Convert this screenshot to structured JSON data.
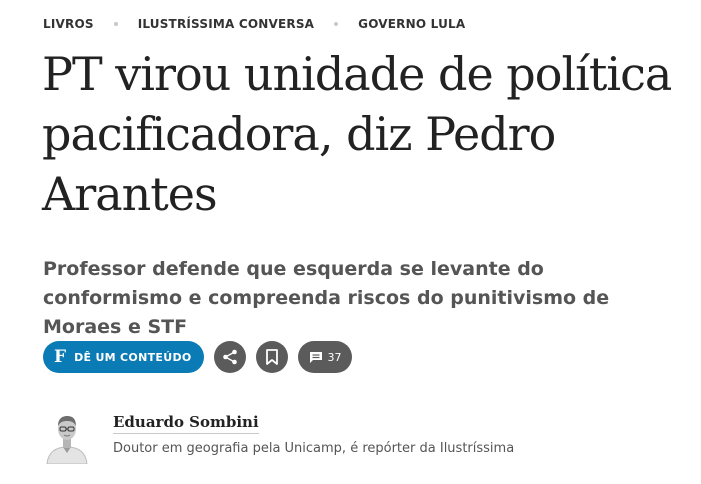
{
  "tags": [
    {
      "label": "LIVROS"
    },
    {
      "label": "ILUSTRÍSSIMA CONVERSA"
    },
    {
      "label": "GOVERNO LULA"
    }
  ],
  "article": {
    "headline": "PT virou unidade de política pacificadora, diz Pedro Arantes",
    "subtitle": "Professor defende que esquerda se levante do conformismo e compreenda riscos do punitivismo de Moraes e STF"
  },
  "actions": {
    "give_logo": "F",
    "give_label": "DÊ UM CONTEÚDO",
    "share_icon": "share-icon",
    "bookmark_icon": "bookmark-icon",
    "comment_icon": "comment-icon",
    "comments_count": "37"
  },
  "author": {
    "name": "Eduardo Sombini",
    "bio": "Doutor em geografia pela Unicamp, é repórter da Ilustríssima"
  },
  "colors": {
    "accent": "#0b7bb5",
    "icon_button": "#5b5b5b",
    "text": "#222222",
    "muted": "#555555"
  }
}
